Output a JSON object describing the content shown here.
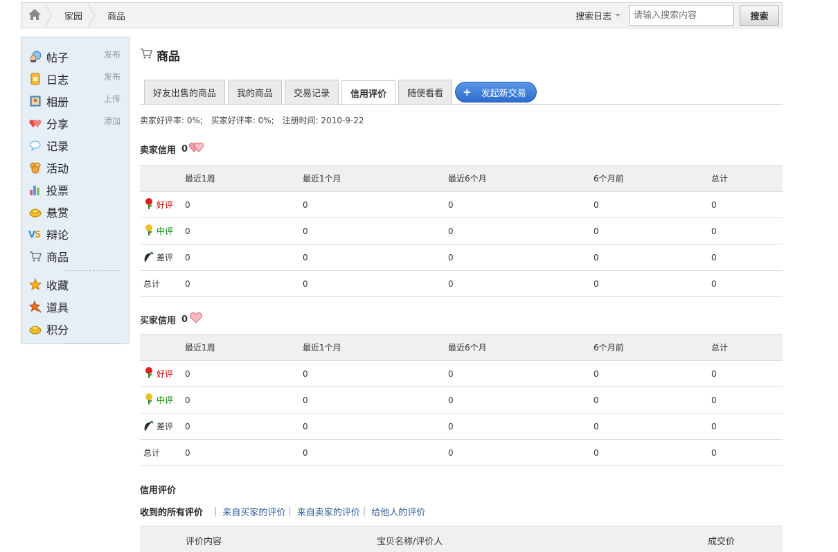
{
  "breadcrumb": {
    "items": [
      "家园",
      "商品"
    ]
  },
  "search": {
    "scope": "搜索日志",
    "placeholder": "请输入搜索内容",
    "button": "搜索"
  },
  "sidebar": {
    "items": [
      {
        "label": "帖子",
        "action": "发布",
        "icon": "forum-icon"
      },
      {
        "label": "日志",
        "action": "发布",
        "icon": "blog-icon"
      },
      {
        "label": "相册",
        "action": "上传",
        "icon": "album-icon"
      },
      {
        "label": "分享",
        "action": "添加",
        "icon": "share-icon"
      },
      {
        "label": "记录",
        "action": "",
        "icon": "doing-icon"
      },
      {
        "label": "活动",
        "action": "",
        "icon": "activity-icon"
      },
      {
        "label": "投票",
        "action": "",
        "icon": "poll-icon"
      },
      {
        "label": "悬赏",
        "action": "",
        "icon": "reward-icon"
      },
      {
        "label": "辩论",
        "action": "",
        "icon": "debate-icon"
      },
      {
        "label": "商品",
        "action": "",
        "icon": "trade-icon"
      }
    ],
    "extra_items": [
      {
        "label": "收藏",
        "icon": "favorite-icon"
      },
      {
        "label": "道具",
        "icon": "magic-icon"
      },
      {
        "label": "积分",
        "icon": "credits-icon"
      }
    ]
  },
  "page": {
    "title": "商品"
  },
  "tabs": [
    "好友出售的商品",
    "我的商品",
    "交易记录",
    "信用评价",
    "随便看看"
  ],
  "active_tab": "信用评价",
  "new_trade_button": "发起新交易",
  "stats": {
    "seller_rate": "卖家好评率: 0%;",
    "buyer_rate": "买家好评率: 0%;",
    "register": "注册时间: 2010-9-22"
  },
  "seller": {
    "title": "卖家信用",
    "score": "0",
    "columns": [
      "",
      "最近1周",
      "最近1个月",
      "最近6个月",
      "6个月前",
      "总计"
    ],
    "rows": [
      {
        "label": "好评",
        "values": [
          "0",
          "0",
          "0",
          "0",
          "0"
        ]
      },
      {
        "label": "中评",
        "values": [
          "0",
          "0",
          "0",
          "0",
          "0"
        ]
      },
      {
        "label": "差评",
        "values": [
          "0",
          "0",
          "0",
          "0",
          "0"
        ]
      },
      {
        "label": "总计",
        "values": [
          "0",
          "0",
          "0",
          "0",
          "0"
        ]
      }
    ]
  },
  "buyer": {
    "title": "买家信用",
    "score": "0",
    "columns": [
      "",
      "最近1周",
      "最近1个月",
      "最近6个月",
      "6个月前",
      "总计"
    ],
    "rows": [
      {
        "label": "好评",
        "values": [
          "0",
          "0",
          "0",
          "0",
          "0"
        ]
      },
      {
        "label": "中评",
        "values": [
          "0",
          "0",
          "0",
          "0",
          "0"
        ]
      },
      {
        "label": "差评",
        "values": [
          "0",
          "0",
          "0",
          "0",
          "0"
        ]
      },
      {
        "label": "总计",
        "values": [
          "0",
          "0",
          "0",
          "0",
          "0"
        ]
      }
    ]
  },
  "reviews": {
    "title": "信用评价",
    "current_filter": "收到的所有评价",
    "filters": [
      "来自买家的评价",
      "来自卖家的评价",
      "给他人的评价"
    ],
    "columns": [
      "评价内容",
      "宝贝名称/评价人",
      "成交价"
    ]
  },
  "colors": {
    "good": "#cc0000",
    "mid": "#008800",
    "link": "#2a5a9a",
    "sidebar_bg": "#e6eef6"
  }
}
